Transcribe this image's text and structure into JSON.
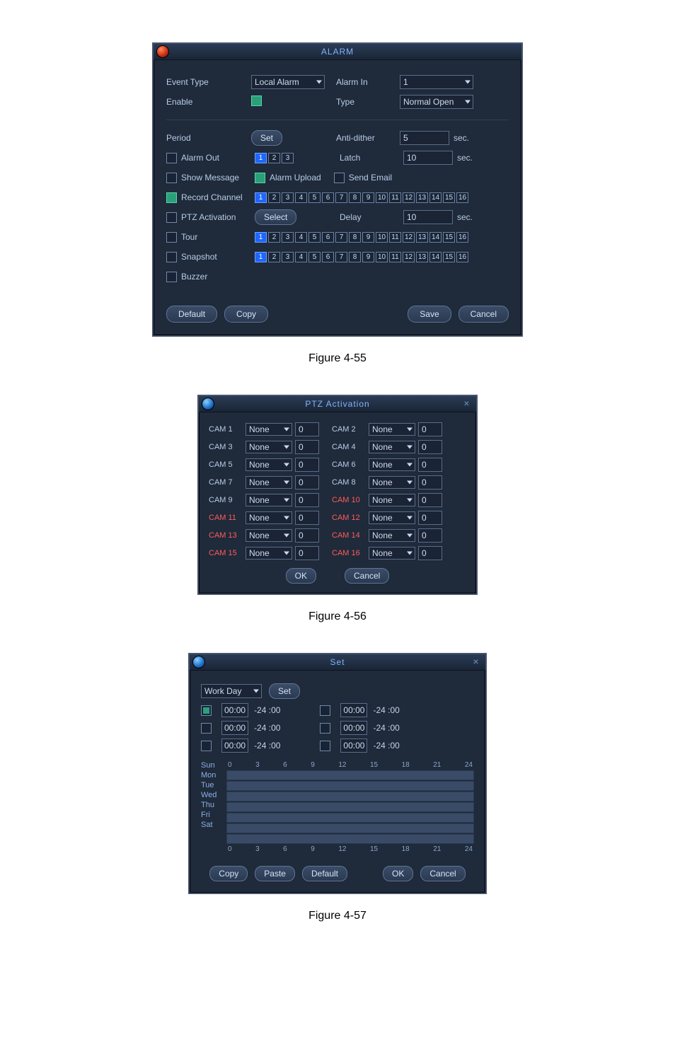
{
  "captions": {
    "f55": "Figure 4-55",
    "f56": "Figure 4-56",
    "f57": "Figure 4-57"
  },
  "alarm": {
    "title": "ALARM",
    "labels": {
      "event_type": "Event Type",
      "enable": "Enable",
      "alarm_in": "Alarm In",
      "type": "Type",
      "period": "Period",
      "anti_dither": "Anti-dither",
      "alarm_out": "Alarm Out",
      "latch": "Latch",
      "show_message": "Show Message",
      "alarm_upload": "Alarm Upload",
      "send_email": "Send Email",
      "record_channel": "Record Channel",
      "ptz_activation": "PTZ Activation",
      "delay": "Delay",
      "tour": "Tour",
      "snapshot": "Snapshot",
      "buzzer": "Buzzer",
      "sec": "sec."
    },
    "values": {
      "event_type": "Local Alarm",
      "alarm_in": "1",
      "type": "Normal Open",
      "anti_dither": "5",
      "latch": "10",
      "delay": "10"
    },
    "buttons": {
      "set": "Set",
      "select": "Select",
      "default": "Default",
      "copy": "Copy",
      "save": "Save",
      "cancel": "Cancel"
    },
    "alarm_out": {
      "channels": [
        "1",
        "2",
        "3"
      ],
      "selected": [
        true,
        false,
        false
      ]
    },
    "record_channel": {
      "channels": [
        "1",
        "2",
        "3",
        "4",
        "5",
        "6",
        "7",
        "8",
        "9",
        "10",
        "11",
        "12",
        "13",
        "14",
        "15",
        "16"
      ],
      "selected_index": 0
    },
    "tour": {
      "channels": [
        "1",
        "2",
        "3",
        "4",
        "5",
        "6",
        "7",
        "8",
        "9",
        "10",
        "11",
        "12",
        "13",
        "14",
        "15",
        "16"
      ],
      "selected_index": 0
    },
    "snapshot": {
      "channels": [
        "1",
        "2",
        "3",
        "4",
        "5",
        "6",
        "7",
        "8",
        "9",
        "10",
        "11",
        "12",
        "13",
        "14",
        "15",
        "16"
      ],
      "selected_index": 0
    },
    "checks": {
      "alarm_out": false,
      "show_message": false,
      "alarm_upload": true,
      "send_email": false,
      "record_channel": true,
      "ptz_activation": false,
      "tour": false,
      "snapshot": false,
      "buzzer": false
    }
  },
  "ptz": {
    "title": "PTZ Activation",
    "preset_value": "None",
    "num_value": "0",
    "cams_left": [
      "CAM 1",
      "CAM 3",
      "CAM 5",
      "CAM 7",
      "CAM 9",
      "CAM 11",
      "CAM 13",
      "CAM 15"
    ],
    "cams_right": [
      "CAM 2",
      "CAM 4",
      "CAM 6",
      "CAM 8",
      "CAM 10",
      "CAM 12",
      "CAM 14",
      "CAM 16"
    ],
    "red_left": [
      false,
      false,
      false,
      false,
      false,
      true,
      true,
      true
    ],
    "red_right": [
      false,
      false,
      false,
      false,
      true,
      true,
      true,
      true
    ],
    "buttons": {
      "ok": "OK",
      "cancel": "Cancel"
    }
  },
  "setd": {
    "title": "Set",
    "work_day_label": "Work Day",
    "set_btn": "Set",
    "time_rows": [
      {
        "s_h": "00",
        "s_m": "00",
        "dash": "-24",
        "e_m": "00",
        "s2_h": "00",
        "s2_m": "00",
        "dash2": "-24",
        "e2_m": "00",
        "chk": true
      },
      {
        "s_h": "00",
        "s_m": "00",
        "dash": "-24",
        "e_m": "00",
        "s2_h": "00",
        "s2_m": "00",
        "dash2": "-24",
        "e2_m": "00",
        "chk": false
      },
      {
        "s_h": "00",
        "s_m": "00",
        "dash": "-24",
        "e_m": "00",
        "s2_h": "00",
        "s2_m": "00",
        "dash2": "-24",
        "e2_m": "00",
        "chk": false
      }
    ],
    "ticks": [
      "0",
      "3",
      "6",
      "9",
      "12",
      "15",
      "18",
      "21",
      "24"
    ],
    "days": [
      "Sun",
      "Mon",
      "Tue",
      "Wed",
      "Thu",
      "Fri",
      "Sat"
    ],
    "buttons": {
      "copy": "Copy",
      "paste": "Paste",
      "default": "Default",
      "ok": "OK",
      "cancel": "Cancel"
    }
  }
}
